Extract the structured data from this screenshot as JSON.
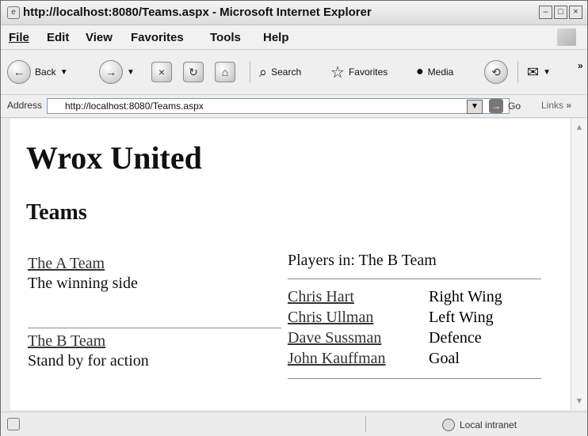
{
  "window": {
    "title": "http://localhost:8080/Teams.aspx - Microsoft Internet Explorer"
  },
  "menu": {
    "items": [
      "File",
      "Edit",
      "View",
      "Favorites",
      "Tools",
      "Help"
    ]
  },
  "toolbar": {
    "back_label": "Back",
    "search_label": "Search",
    "favorites_label": "Favorites",
    "media_label": "Media"
  },
  "address": {
    "label": "Address",
    "url": "http://localhost:8080/Teams.aspx",
    "go_label": "Go",
    "links_label": "Links"
  },
  "page": {
    "site_title": "Wrox United",
    "section_title": "Teams",
    "teams": [
      {
        "name": "The A Team",
        "description": "The winning side"
      },
      {
        "name": "The B Team",
        "description": "Stand by for action"
      }
    ],
    "players_header": "Players in: The B Team",
    "players": [
      {
        "name": "Chris Hart",
        "position": "Right Wing"
      },
      {
        "name": "Chris Ullman",
        "position": "Left Wing"
      },
      {
        "name": "Dave Sussman",
        "position": "Defence"
      },
      {
        "name": "John Kauffman",
        "position": "Goal"
      }
    ]
  },
  "status": {
    "zone": "Local intranet"
  },
  "colors": {
    "link": "#333333",
    "rule": "#8d8d8d"
  }
}
